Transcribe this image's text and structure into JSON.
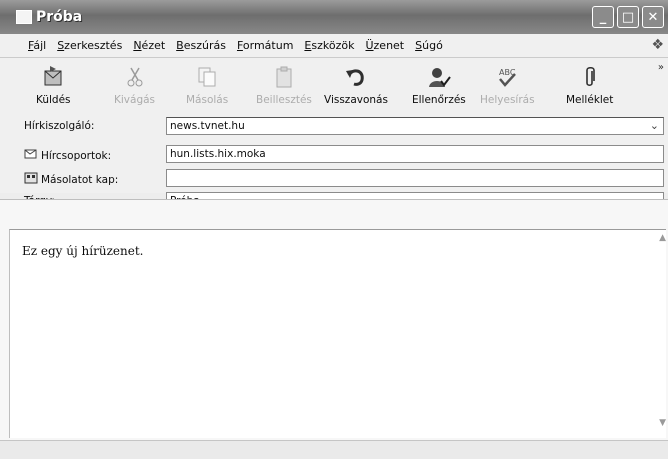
{
  "window": {
    "title": "Próba"
  },
  "menu": [
    "Fájl",
    "Szerkesztés",
    "Nézet",
    "Beszúrás",
    "Formátum",
    "Eszközök",
    "Üzenet",
    "Súgó"
  ],
  "toolbar": {
    "send": "Küldés",
    "cut": "Kivágás",
    "copy": "Másolás",
    "paste": "Beillesztés",
    "undo": "Visszavonás",
    "check": "Ellenőrzés",
    "spelling": "Helyesírás",
    "attach": "Melléklet"
  },
  "fields": {
    "server_label": "Hírkiszolgáló:",
    "server_value": "news.tvnet.hu",
    "groups_label": "Hírcsoportok:",
    "groups_value": "hun.lists.hix.moka",
    "cc_label": "Másolatot kap:",
    "cc_value": "",
    "subject_label": "Tárgy:",
    "subject_value": "Próba"
  },
  "message": {
    "body": "Ez egy új hírüzenet."
  },
  "colors": {
    "titlebar": "#7f7f7f",
    "chrome": "#ecebe5",
    "field_bg": "#ffffff"
  }
}
